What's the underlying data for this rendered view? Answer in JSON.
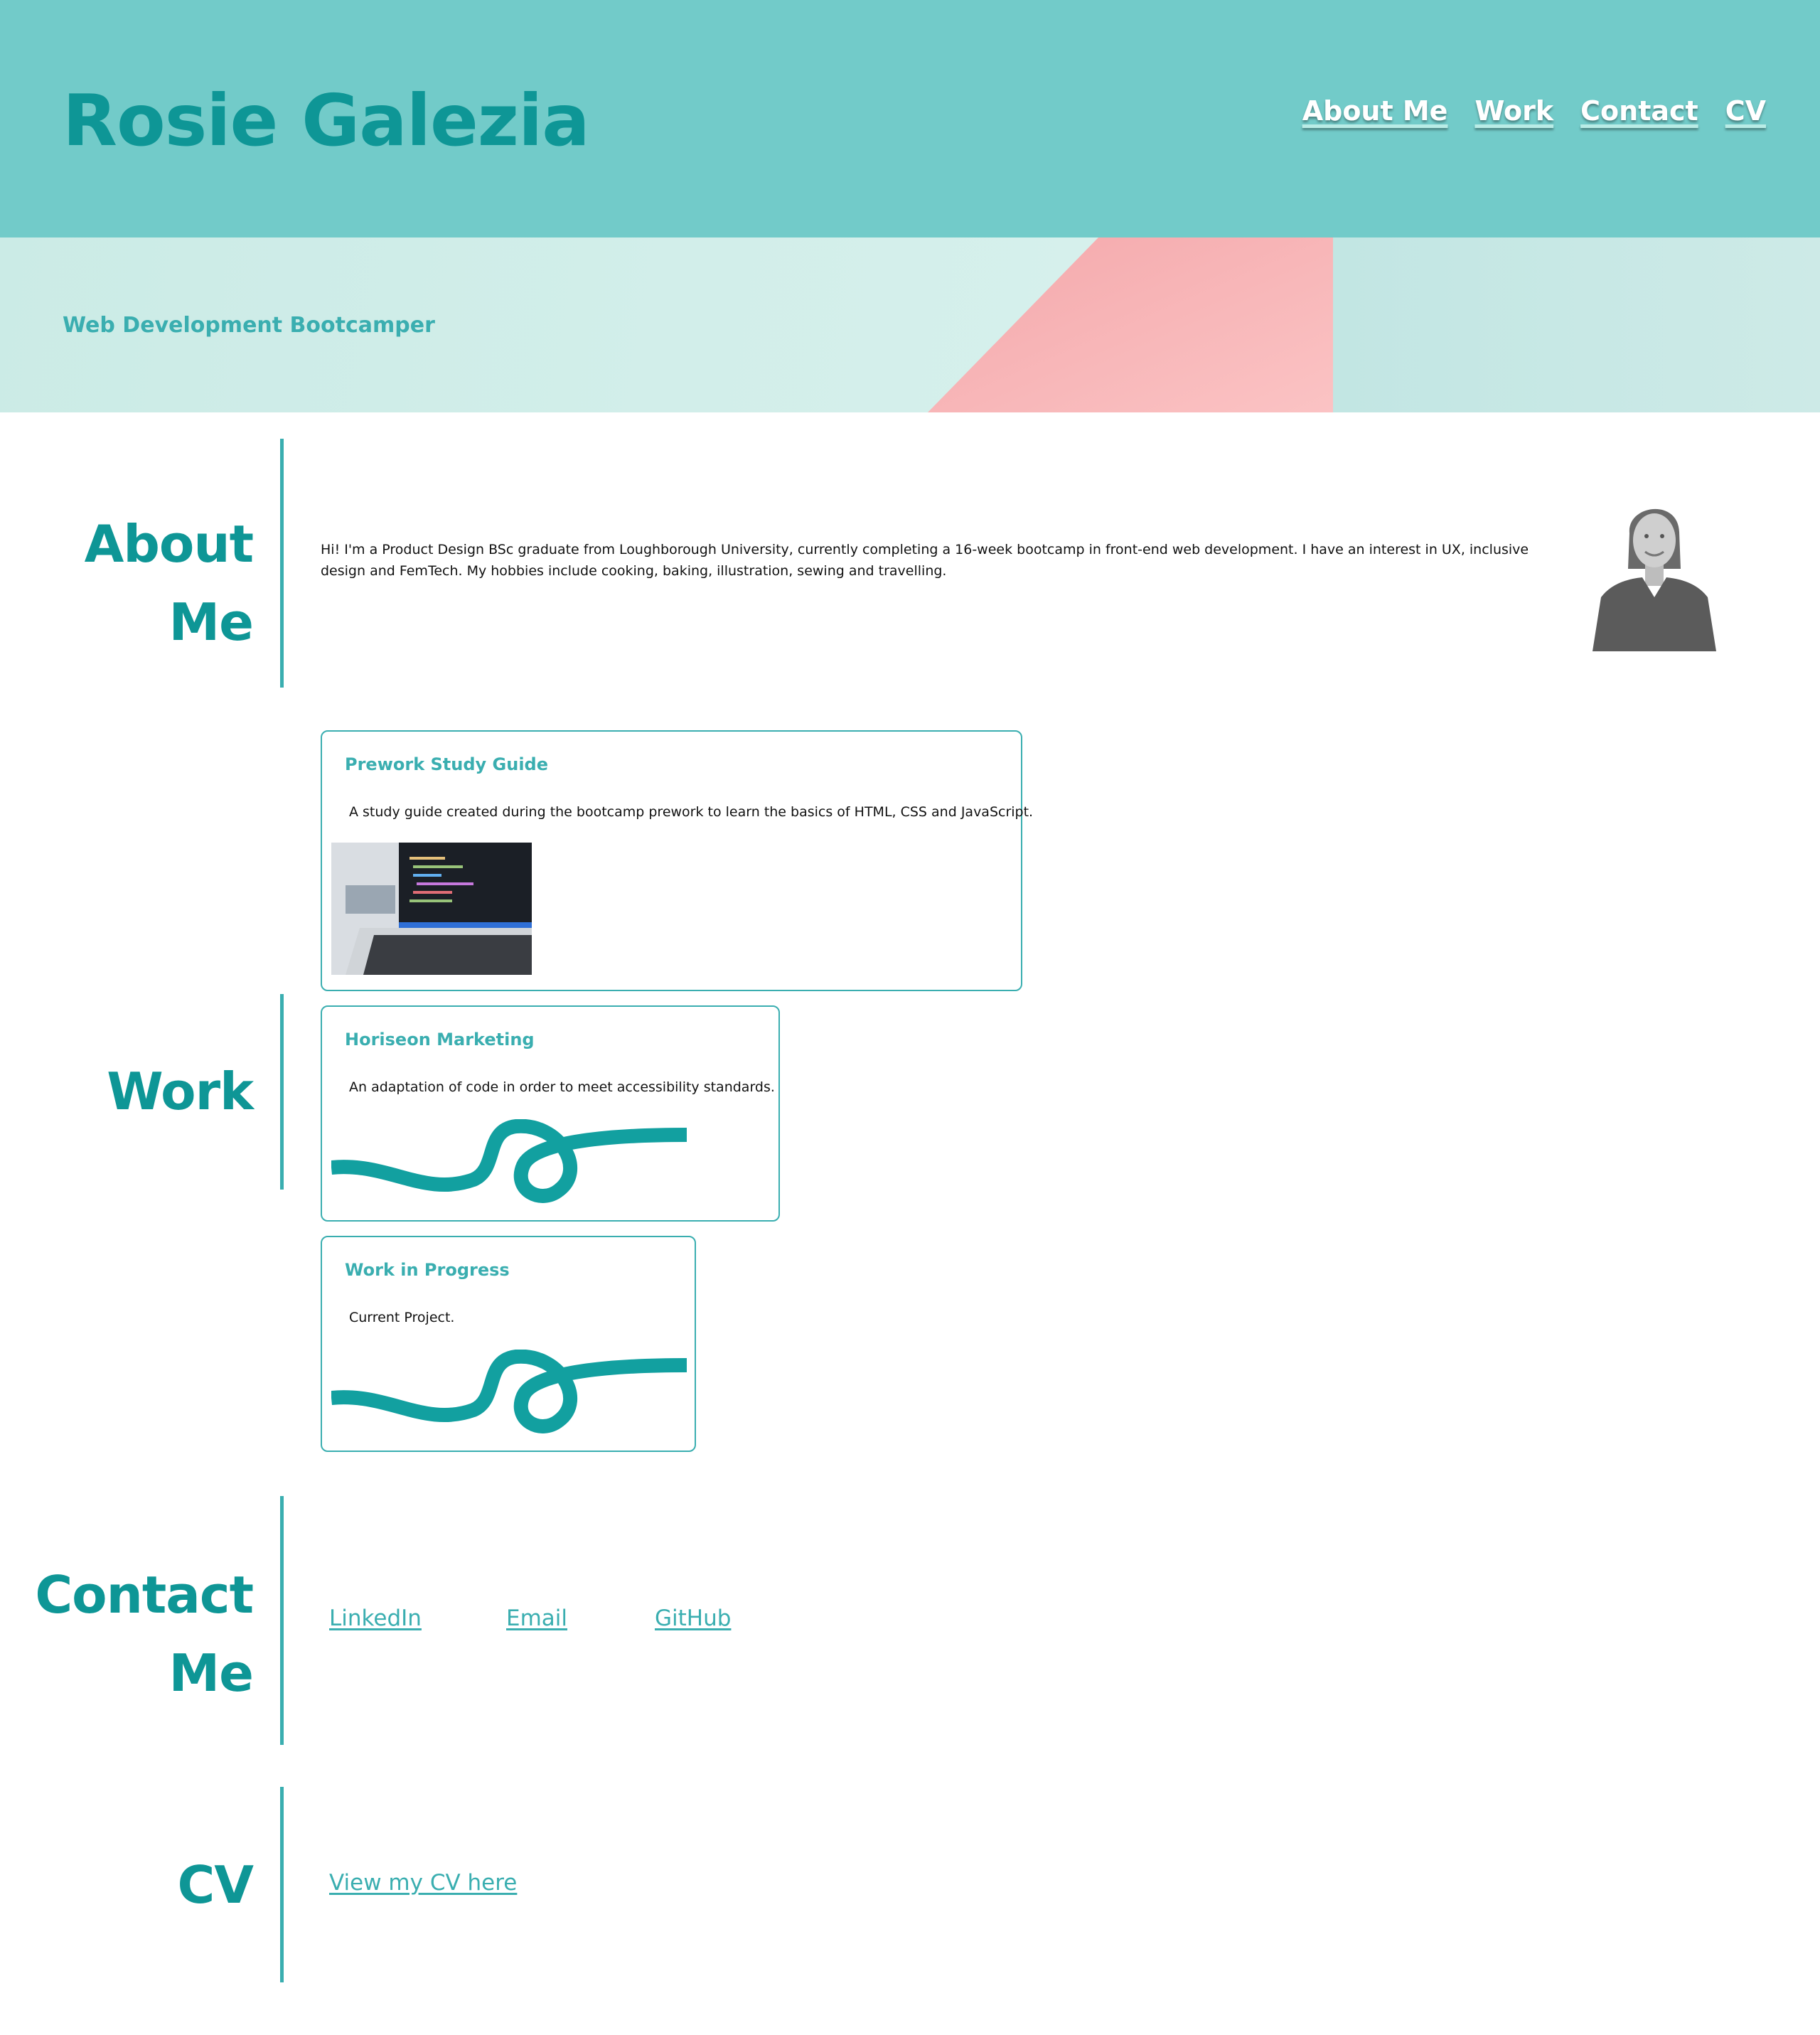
{
  "header": {
    "site_title": "Rosie Galezia",
    "nav": [
      "About Me",
      "Work",
      "Contact",
      "CV"
    ]
  },
  "hero": {
    "subtitle": "Web Development Bootcamper"
  },
  "about": {
    "heading_line1": "About",
    "heading_line2": "Me",
    "text": "Hi! I'm a Product Design BSc graduate from Loughborough University, currently completing a 16-week bootcamp in front-end web development. I have an interest in UX, inclusive design and FemTech. My hobbies include cooking, baking, illustration, sewing and travelling."
  },
  "work": {
    "heading": "Work",
    "projects": [
      {
        "title": "Prework Study Guide",
        "description": "A study guide created during the bootcamp prework to learn the basics of HTML, CSS and JavaScript."
      },
      {
        "title": "Horiseon Marketing",
        "description": "An adaptation of code in order to meet accessibility standards."
      },
      {
        "title": "Work in Progress",
        "description": "Current Project."
      }
    ]
  },
  "contact": {
    "heading_line1": "Contact",
    "heading_line2": "Me",
    "links": [
      "LinkedIn",
      "Email",
      "GitHub"
    ]
  },
  "cv": {
    "heading": "CV",
    "link": "View my CV here"
  },
  "colors": {
    "header_bg": "#72cbc9",
    "accent_dark": "#0e9696",
    "accent": "#3aaeb0",
    "hero_pink": "#f7b7b8"
  }
}
